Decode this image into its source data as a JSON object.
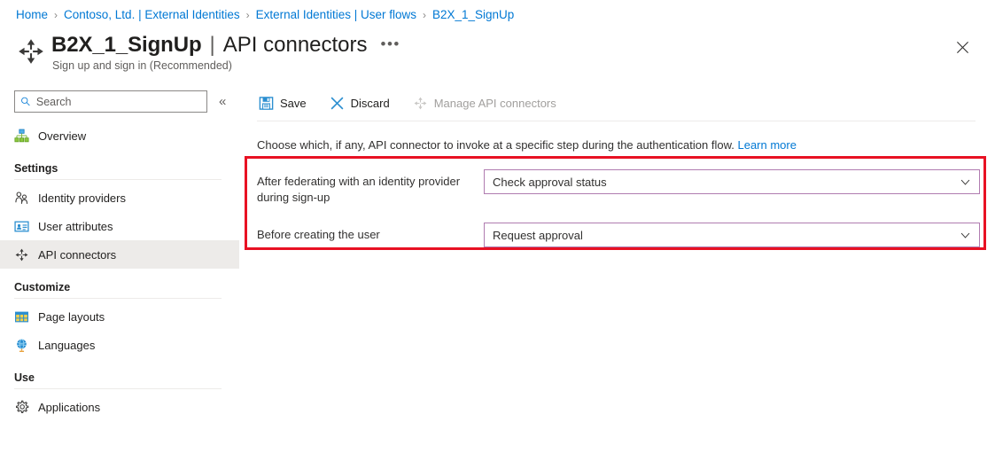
{
  "breadcrumb": {
    "items": [
      {
        "label": "Home"
      },
      {
        "label": "Contoso, Ltd. | External Identities"
      },
      {
        "label": "External Identities | User flows"
      },
      {
        "label": "B2X_1_SignUp"
      }
    ],
    "separator": "›"
  },
  "header": {
    "icon": "api-connectors-icon",
    "title": "B2X_1_SignUp",
    "separator": "|",
    "section": "API connectors",
    "ellipsis": "•••",
    "subtitle": "Sign up and sign in (Recommended)",
    "close_icon": "close-icon"
  },
  "sidebar": {
    "search": {
      "placeholder": "Search",
      "value": "",
      "icon": "search-icon"
    },
    "collapse": {
      "icon": "double-chevron-left-icon",
      "glyph": "«"
    },
    "items": [
      {
        "label": "Overview",
        "icon": "overview-hierarchy-icon",
        "selected": false
      }
    ],
    "groups": [
      {
        "title": "Settings",
        "items": [
          {
            "label": "Identity providers",
            "icon": "people-icon",
            "selected": false
          },
          {
            "label": "User attributes",
            "icon": "id-badge-icon",
            "selected": false
          },
          {
            "label": "API connectors",
            "icon": "api-connectors-icon",
            "selected": true
          }
        ]
      },
      {
        "title": "Customize",
        "items": [
          {
            "label": "Page layouts",
            "icon": "table-grid-icon",
            "selected": false
          },
          {
            "label": "Languages",
            "icon": "globe-icon",
            "selected": false
          }
        ]
      },
      {
        "title": "Use",
        "items": [
          {
            "label": "Applications",
            "icon": "gear-icon",
            "selected": false
          }
        ]
      }
    ]
  },
  "toolbar": {
    "save_label": "Save",
    "save_icon": "save-floppy-icon",
    "discard_label": "Discard",
    "discard_icon": "discard-x-icon",
    "manage_label": "Manage API connectors",
    "manage_icon": "api-connectors-icon",
    "manage_disabled": true
  },
  "main": {
    "description": "Choose which, if any, API connector to invoke at a specific step during the authentication flow.",
    "learn_more": "Learn more",
    "fields": [
      {
        "label": "After federating with an identity provider during sign-up",
        "value": "Check approval status",
        "chevron": "chevron-down-icon"
      },
      {
        "label": "Before creating the user",
        "value": "Request approval",
        "chevron": "chevron-down-icon"
      }
    ]
  },
  "annotation": {
    "type": "highlight-rectangle",
    "color": "#e81123"
  },
  "colors": {
    "link": "#0078d4",
    "dropdown_border": "#b07cb0",
    "annotation_red": "#e81123",
    "selected_nav": "#edebe9",
    "text_primary": "#201f1e",
    "text_secondary": "#605e5c"
  }
}
